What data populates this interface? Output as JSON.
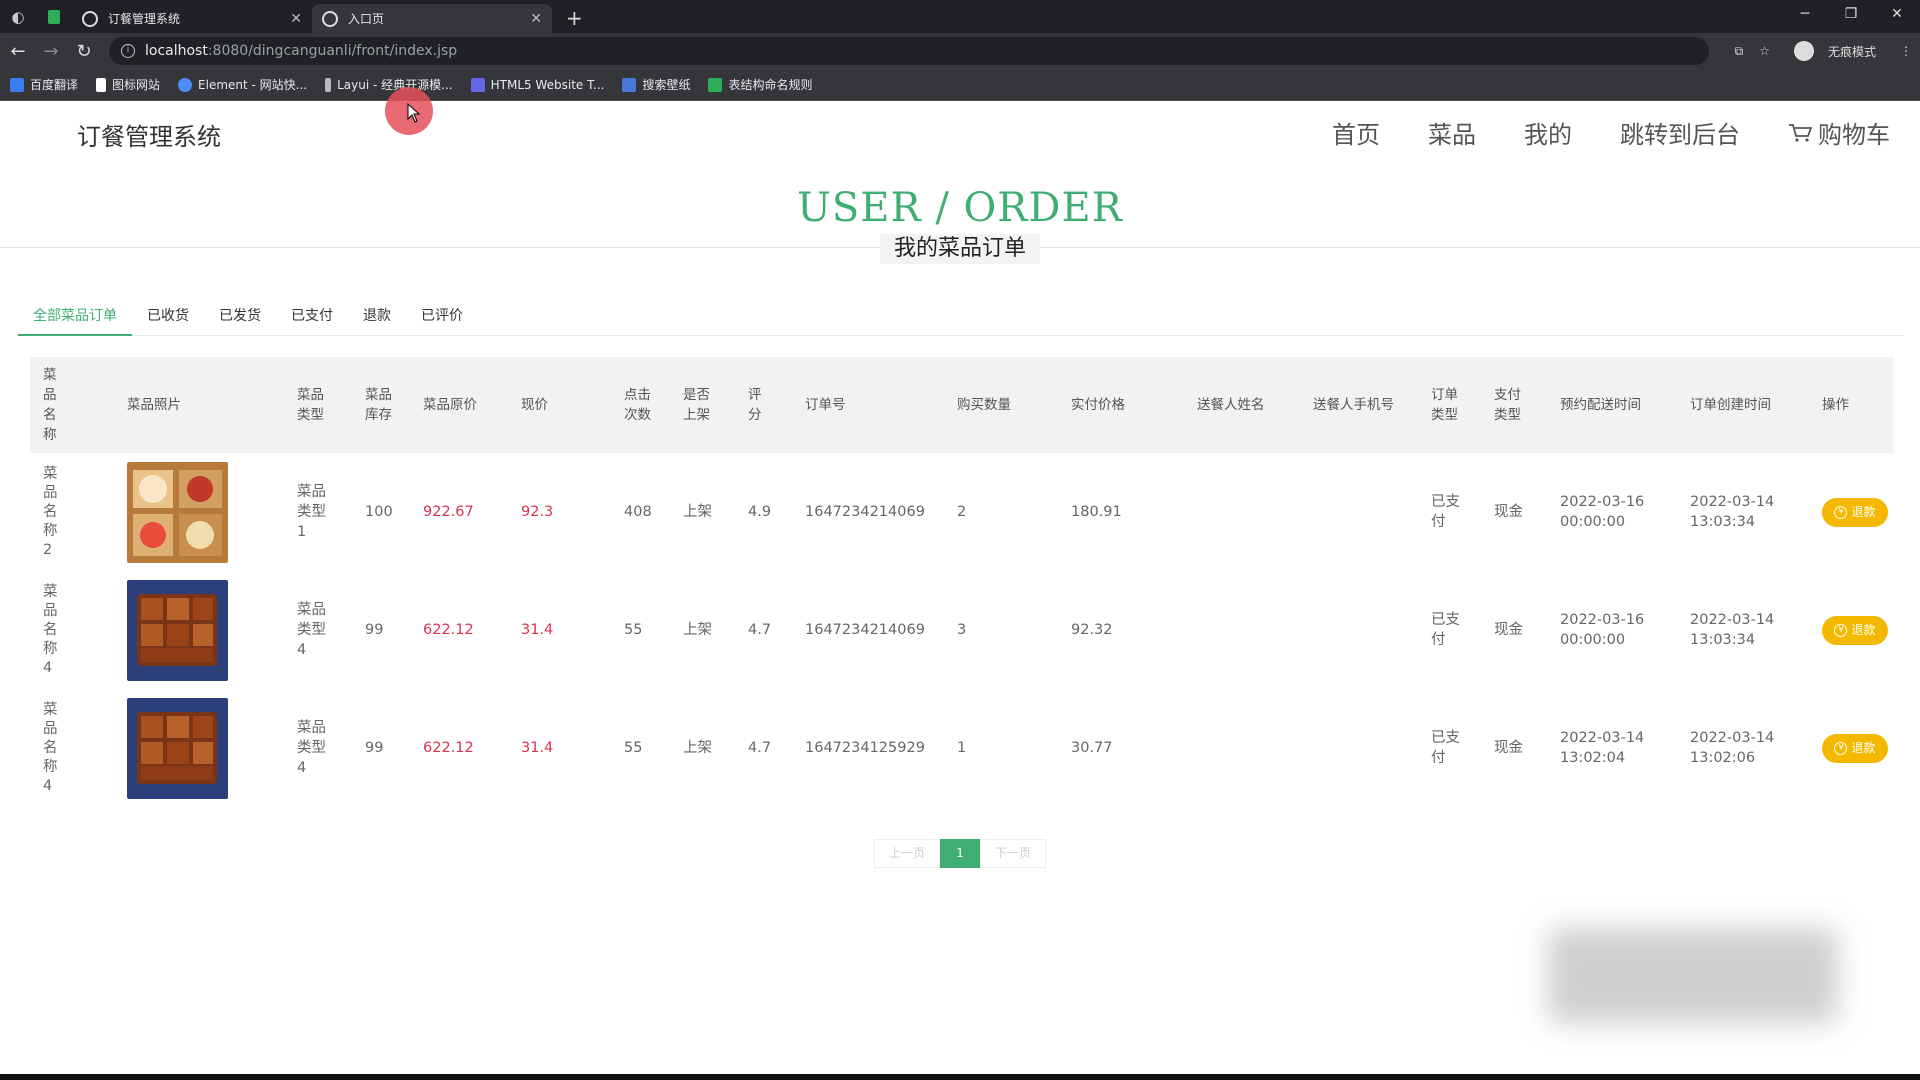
{
  "browser": {
    "tabs": [
      {
        "title": "订餐管理系统"
      },
      {
        "title": "入口页"
      }
    ],
    "new_tab": "+",
    "url_host": "localhost",
    "url_path": ":8080/dingcanguanli/front/index.jsp",
    "profile": "无痕模式",
    "bookmarks": [
      {
        "label": "百度翻译",
        "color": "#3b7cf0"
      },
      {
        "label": "图标网站",
        "color": "#ffffff"
      },
      {
        "label": "Element - 网站快...",
        "color": "#4e8cf7"
      },
      {
        "label": "Layui - 经典开源模...",
        "color": "#bbbbbb"
      },
      {
        "label": "HTML5 Website T...",
        "color": "#6464e6"
      },
      {
        "label": "搜索壁纸",
        "color": "#4a78d8"
      },
      {
        "label": "表结构命名规则",
        "color": "#2fae5a"
      }
    ]
  },
  "site": {
    "logo": "订餐管理系统",
    "nav": [
      "首页",
      "菜品",
      "我的",
      "跳转到后台",
      "购物车"
    ]
  },
  "page": {
    "title_en": "USER / ORDER",
    "title_cn": "我的菜品订单"
  },
  "order_tabs": [
    "全部菜品订单",
    "已收货",
    "已发货",
    "已支付",
    "退款",
    "已评价"
  ],
  "table": {
    "headers": [
      "菜品名称",
      "菜品照片",
      "菜品类型",
      "菜品库存",
      "菜品原价",
      "现价",
      "点击次数",
      "是否上架",
      "评分",
      "订单号",
      "购买数量",
      "实付价格",
      "送餐人姓名",
      "送餐人手机号",
      "订单类型",
      "支付类型",
      "预约配送时间",
      "订单创建时间",
      "操作"
    ],
    "rows": [
      {
        "name": "菜品名称2",
        "type": "菜品类型1",
        "stock": "100",
        "orig": "922.67",
        "price": "92.3",
        "clicks": "408",
        "onsale": "上架",
        "score": "4.9",
        "order_no": "1647234214069",
        "qty": "2",
        "paid": "180.91",
        "courier": "",
        "courier_phone": "",
        "order_type": "已支付",
        "pay_type": "现金",
        "delivery_time": "2022-03-16 00:00:00",
        "created": "2022-03-14 13:03:34",
        "action": "退款"
      },
      {
        "name": "菜品名称4",
        "type": "菜品类型4",
        "stock": "99",
        "orig": "622.12",
        "price": "31.4",
        "clicks": "55",
        "onsale": "上架",
        "score": "4.7",
        "order_no": "1647234214069",
        "qty": "3",
        "paid": "92.32",
        "courier": "",
        "courier_phone": "",
        "order_type": "已支付",
        "pay_type": "现金",
        "delivery_time": "2022-03-16 00:00:00",
        "created": "2022-03-14 13:03:34",
        "action": "退款"
      },
      {
        "name": "菜品名称4",
        "type": "菜品类型4",
        "stock": "99",
        "orig": "622.12",
        "price": "31.4",
        "clicks": "55",
        "onsale": "上架",
        "score": "4.7",
        "order_no": "1647234125929",
        "qty": "1",
        "paid": "30.77",
        "courier": "",
        "courier_phone": "",
        "order_type": "已支付",
        "pay_type": "现金",
        "delivery_time": "2022-03-14 13:02:04",
        "created": "2022-03-14 13:02:06",
        "action": "退款"
      }
    ]
  },
  "pager": {
    "prev": "上一页",
    "current": "1",
    "next": "下一页"
  },
  "colors": {
    "accent": "#3fae73",
    "price_red": "#d9334c",
    "refund_yellow": "#f5b800"
  }
}
